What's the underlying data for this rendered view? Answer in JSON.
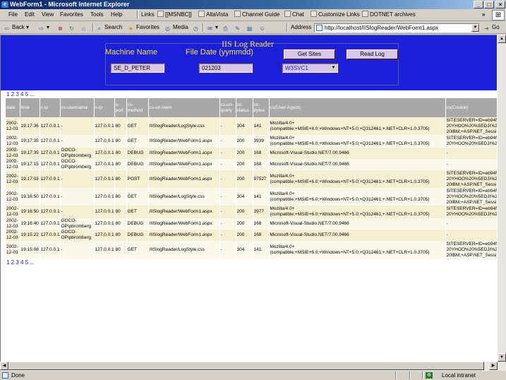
{
  "window": {
    "title": "WebForm1 - Microsoft Internet Explorer",
    "btn_min": "_",
    "btn_max": "□",
    "btn_close": "×"
  },
  "menu": [
    "File",
    "Edit",
    "View",
    "Favorites",
    "Tools",
    "Help"
  ],
  "links_label": "Links",
  "links": [
    "[[MSNBC]]",
    "AltaVista",
    "Channel Guide",
    "Chat",
    "Customize Links",
    "DOTNET archives"
  ],
  "toolbar": {
    "back": "Back",
    "search": "Search",
    "favorites": "Favorites",
    "media": "Media",
    "address_label": "Address",
    "address": "http://localhost/IISlogReader/WebForm1.aspx",
    "go": "Go"
  },
  "status": {
    "left": "Done",
    "right": "Local intranet"
  },
  "header": {
    "title": "IIS Log Reader",
    "machine_label": "Machine Name",
    "date_label": "File Date (yymmdd)",
    "machine_value": "SE_D_PETER",
    "date_value": "021203",
    "get_sites": "Get Sites",
    "read_log": "Read Log",
    "site_select": "W3SVC1"
  },
  "pager": "1 2 3 4 5 ...",
  "columns": [
    "date",
    "time",
    "c-ip",
    "cs-username",
    "s-ip",
    "s-port",
    "cs-method",
    "cs-uri-stem",
    "cs-uri-query",
    "sc-status",
    "sc-bytes",
    "cs(User-Agent)",
    "cs(Cookie)"
  ],
  "rows": [
    [
      "2002-12-03",
      "19:17:36",
      "127.0.0.1",
      "-",
      "127.0.0.1",
      "80",
      "GET",
      "/IISlogReader/LogStyle.css",
      "-",
      "304",
      "141",
      "Mozilla/4.0+ (compatible;+MSIE+6.0;+Windows+NT+5.0;+Q312461;+.NET+CLR+1.0.3705)",
      "SITESERVER=ID=eb94f 20YHOO%20%5EDJI%2 20IBM;+ASP.NET_Sessi"
    ],
    [
      "2002-12-03",
      "19:17:35",
      "127.0.0.1",
      "-",
      "127.0.0.1",
      "80",
      "GET",
      "/IISlogReader/WebForm1.aspx",
      "-",
      "200",
      "3939",
      "Mozilla/4.0+ (compatible;+MSIE+6.0;+Windows+NT+5.0;+Q312461;+.NET+CLR+1.0.3705)",
      "SITESERVER=ID=eb94f 20YHOO%20%5EDJI%2"
    ],
    [
      "2002-12-03",
      "19:17:35",
      "127.0.0.1",
      "GOCO-OP\\pbromberg",
      "127.0.0.1",
      "80",
      "DEBUG",
      "/IISlogReader/WebForm1.aspx",
      "-",
      "200",
      "168",
      "Microsoft-Visual-Studio.NET/7.00.9466",
      "-"
    ],
    [
      "2002-12-03",
      "19:17:15",
      "127.0.0.1",
      "GOCO-OP\\pbromberg",
      "127.0.0.1",
      "80",
      "DEBUG",
      "/IISlogReader/WebForm1.aspx",
      "-",
      "200",
      "168",
      "Microsoft-Visual-Studio.NET/7.00.9466",
      "-"
    ],
    [
      "2002-12-03",
      "19:17:03",
      "127.0.0.1",
      "-",
      "127.0.0.1",
      "80",
      "POST",
      "/IISlogReader/WebForm1.aspx",
      "-",
      "200",
      "97527",
      "Mozilla/4.0+ (compatible;+MSIE+6.0;+Windows+NT+5.0;+Q312461;+.NET+CLR+1.0.3705)",
      "SITESERVER=ID=eb94f 20YHOO%20%5EDJI%2 20IBM;+ASP.NET_Sessi"
    ],
    [
      "2002-12-03",
      "19:16:50",
      "127.0.0.1",
      "-",
      "127.0.0.1",
      "80",
      "GET",
      "/IISlogReader/LogStyle.css",
      "-",
      "304",
      "141",
      "Mozilla/4.0+ (compatible;+MSIE+6.0;+Windows+NT+5.0;+Q312461;+.NET+CLR+1.0.3705)",
      "SITESERVER=ID=eb94f 20YHOO%20%5EDJI%2 20IBM;+ASP.NET_Sessi"
    ],
    [
      "2002-12-03",
      "19:16:50",
      "127.0.0.1",
      "-",
      "127.0.0.1",
      "80",
      "GET",
      "/IISlogReader/WebForm1.aspx",
      "-",
      "200",
      "3977",
      "Mozilla/4.0+ (compatible;+MSIE+6.0;+Windows+NT+5.0;+Q312461;+.NET+CLR+1.0.3705)",
      "SITESERVER=ID=eb94f 20YHOO%20%5EDJI%2"
    ],
    [
      "2002-12-03",
      "19:16:40",
      "127.0.0.1",
      "GOCO-OP\\pbromberg",
      "127.0.0.1",
      "80",
      "DEBUG",
      "/IISlogReader/WebForm1.aspx",
      "-",
      "200",
      "168",
      "Microsoft-Visual-Studio.NET/7.00.9466",
      "-"
    ],
    [
      "2002-12-03",
      "19:15:22",
      "127.0.0.1",
      "GOCO-OP\\pbromberg",
      "127.0.0.1",
      "80",
      "DEBUG",
      "/IISlogReader/WebForm1.aspx",
      "-",
      "200",
      "168",
      "Microsoft-Visual-Studio.NET/7.00.9466",
      "-"
    ],
    [
      "2002-12-03",
      "19:15:08",
      "127.0.0.1",
      "-",
      "127.0.0.1",
      "80",
      "GET",
      "/IISlogReader/LogStyle.css",
      "-",
      "304",
      "141",
      "Mozilla/4.0+ (compatible;+MSIE+6.0;+Windows+NT+5.0;+Q312461;+.NET+CLR+1.0.3705)",
      "SITESERVER=ID=eb94f 20YHOO%20%5EDJI%2 20IBM;+ASP.NET_Sessi"
    ]
  ],
  "colors": {
    "banner": "#1a1fd8",
    "header_text": "#f7e14b",
    "row_odd": "#f5f0d4",
    "row_even": "#faf8ea",
    "header_bg": "#a8a8a8"
  }
}
